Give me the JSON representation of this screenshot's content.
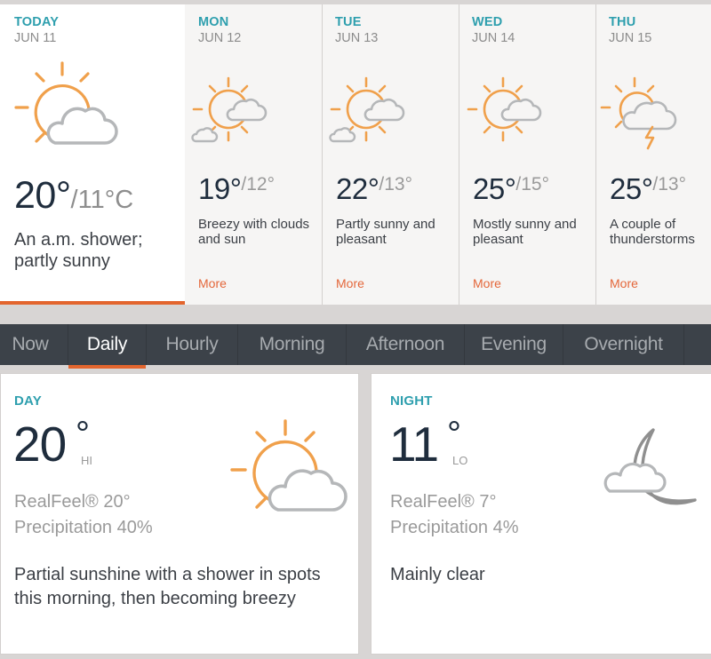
{
  "forecast": [
    {
      "day": "TODAY",
      "date": "JUN 11",
      "icon": "sun-cloud-icon",
      "high": "20°",
      "low": "/11°C",
      "phrase": "An a.m. shower; partly sunny",
      "selected": true
    },
    {
      "day": "MON",
      "date": "JUN 12",
      "icon": "sun-clouds-icon",
      "high": "19°",
      "low": "/12°",
      "phrase": "Breezy with clouds and sun",
      "more": "More"
    },
    {
      "day": "TUE",
      "date": "JUN 13",
      "icon": "sun-clouds-icon",
      "high": "22°",
      "low": "/13°",
      "phrase": "Partly sunny and pleasant",
      "more": "More"
    },
    {
      "day": "WED",
      "date": "JUN 14",
      "icon": "sun-small-cloud-icon",
      "high": "25°",
      "low": "/15°",
      "phrase": "Mostly sunny and pleasant",
      "more": "More"
    },
    {
      "day": "THU",
      "date": "JUN 15",
      "icon": "sun-thunderstorm-icon",
      "high": "25°",
      "low": "/13°",
      "phrase": "A couple of thunderstorms",
      "more": "More"
    }
  ],
  "tabs": [
    {
      "label": "Now"
    },
    {
      "label": "Daily",
      "active": true
    },
    {
      "label": "Hourly"
    },
    {
      "label": "Morning"
    },
    {
      "label": "Afternoon"
    },
    {
      "label": "Evening"
    },
    {
      "label": "Overnight"
    },
    {
      "label": ""
    }
  ],
  "day_panel": {
    "label": "DAY",
    "temp": "20",
    "degree": "°",
    "hilo": "HI",
    "realfeel": "RealFeel® 20°",
    "precipitation": "Precipitation 40%",
    "phrase": "Partial sunshine with a shower in spots this morning, then becoming breezy",
    "icon": "sun-cloud-icon"
  },
  "night_panel": {
    "label": "NIGHT",
    "temp": "11",
    "degree": "°",
    "hilo": "LO",
    "realfeel": "RealFeel® 7°",
    "precipitation": "Precipitation 4%",
    "phrase": "Mainly clear",
    "icon": "moon-cloud-icon"
  },
  "colors": {
    "accent": "#e3652d",
    "label_teal": "#2e9fae",
    "sun_orange": "#f0a04b",
    "cloud_gray": "#b5b7b9",
    "moon_gray": "#8f8f8f",
    "tabbar_bg": "#3c4249",
    "temp_dark": "#1f2d3d"
  }
}
